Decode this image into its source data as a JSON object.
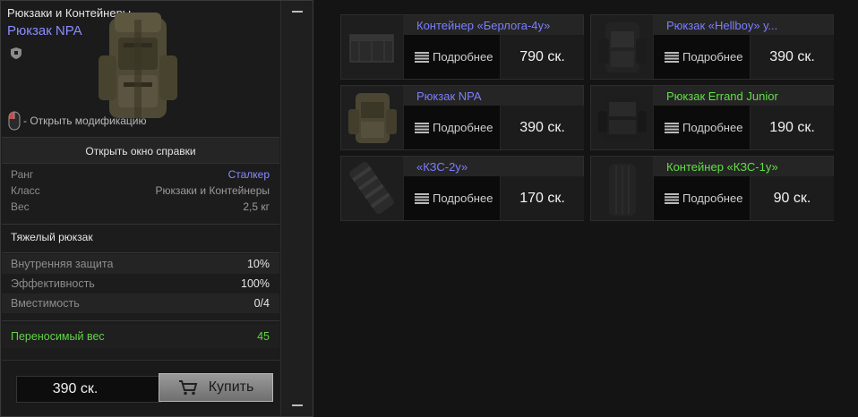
{
  "detail": {
    "category": "Рюкзаки и Контейнеры",
    "item_name": "Рюкзак NPA",
    "hint": "- Открыть модификацию",
    "help_button": "Открыть окно справки",
    "properties": [
      {
        "label": "Ранг",
        "value": "Сталкер"
      },
      {
        "label": "Класс",
        "value": "Рюкзаки и Контейнеры"
      },
      {
        "label": "Вес",
        "value": "2,5 кг"
      }
    ],
    "type_label": "Тяжелый рюкзак",
    "stats": [
      {
        "label": "Внутренняя защита",
        "value": "10%"
      },
      {
        "label": "Эффективность",
        "value": "100%"
      },
      {
        "label": "Вместимость",
        "value": "0/4"
      }
    ],
    "carry": {
      "label": "Переносимый вес",
      "value": "45"
    },
    "price": "390 ск.",
    "buy_label": "Купить"
  },
  "items": [
    {
      "name": "Контейнер «Берлога-4у»",
      "color": "blue",
      "details": "Подробнее",
      "price": "790 ск.",
      "icon": "container-icon"
    },
    {
      "name": "Рюкзак «Hellboy» у...",
      "color": "blue",
      "details": "Подробнее",
      "price": "390 ск.",
      "icon": "backpack-dark-icon"
    },
    {
      "name": "Рюкзак NPA",
      "color": "blue",
      "details": "Подробнее",
      "price": "390 ск.",
      "icon": "backpack-camo-icon"
    },
    {
      "name": "Рюкзак Errand Junior",
      "color": "green",
      "details": "Подробнее",
      "price": "190 ск.",
      "icon": "backpack-black-icon"
    },
    {
      "name": "«КЗС-2у»",
      "color": "blue",
      "details": "Подробнее",
      "price": "170 ск.",
      "icon": "kzs-container-icon"
    },
    {
      "name": "Контейнер «КЗС-1у»",
      "color": "green",
      "details": "Подробнее",
      "price": "90 ск.",
      "icon": "kzs-small-icon"
    }
  ],
  "colors": {
    "blue_name": "#7c7eff",
    "green_name": "#5fe045",
    "carry": "#61d447"
  }
}
